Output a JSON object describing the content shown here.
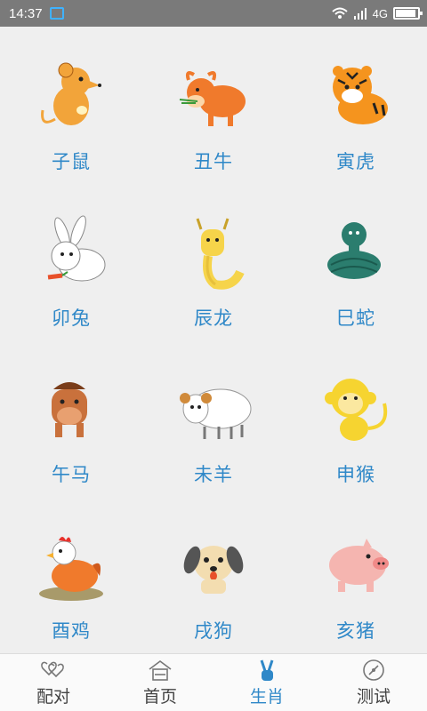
{
  "status_bar": {
    "time": "14:37",
    "network": "4G"
  },
  "zodiac": [
    {
      "label": "子鼠",
      "icon": "rat-icon",
      "color": "#f2a43a"
    },
    {
      "label": "丑牛",
      "icon": "ox-icon",
      "color": "#f07a2c"
    },
    {
      "label": "寅虎",
      "icon": "tiger-icon",
      "color": "#f5941e"
    },
    {
      "label": "卯兔",
      "icon": "rabbit-icon",
      "color": "#ffffff"
    },
    {
      "label": "辰龙",
      "icon": "dragon-icon",
      "color": "#f6d44a"
    },
    {
      "label": "巳蛇",
      "icon": "snake-icon",
      "color": "#2b7d6e"
    },
    {
      "label": "午马",
      "icon": "horse-icon",
      "color": "#c9713c"
    },
    {
      "label": "未羊",
      "icon": "sheep-icon",
      "color": "#ffffff"
    },
    {
      "label": "申猴",
      "icon": "monkey-icon",
      "color": "#f6d430"
    },
    {
      "label": "酉鸡",
      "icon": "rooster-icon",
      "color": "#f07a2c"
    },
    {
      "label": "戌狗",
      "icon": "dog-icon",
      "color": "#f3ddb0"
    },
    {
      "label": "亥猪",
      "icon": "pig-icon",
      "color": "#f5b5b0"
    }
  ],
  "bottom_nav": [
    {
      "label": "配对",
      "icon": "hearts-icon",
      "active": false
    },
    {
      "label": "首页",
      "icon": "home-icon",
      "active": false
    },
    {
      "label": "生肖",
      "icon": "victory-hand-icon",
      "active": true
    },
    {
      "label": "测试",
      "icon": "compass-icon",
      "active": false
    }
  ],
  "colors": {
    "accent": "#2f88c8",
    "status_bar": "#7a7a7a",
    "background": "#efefef"
  }
}
